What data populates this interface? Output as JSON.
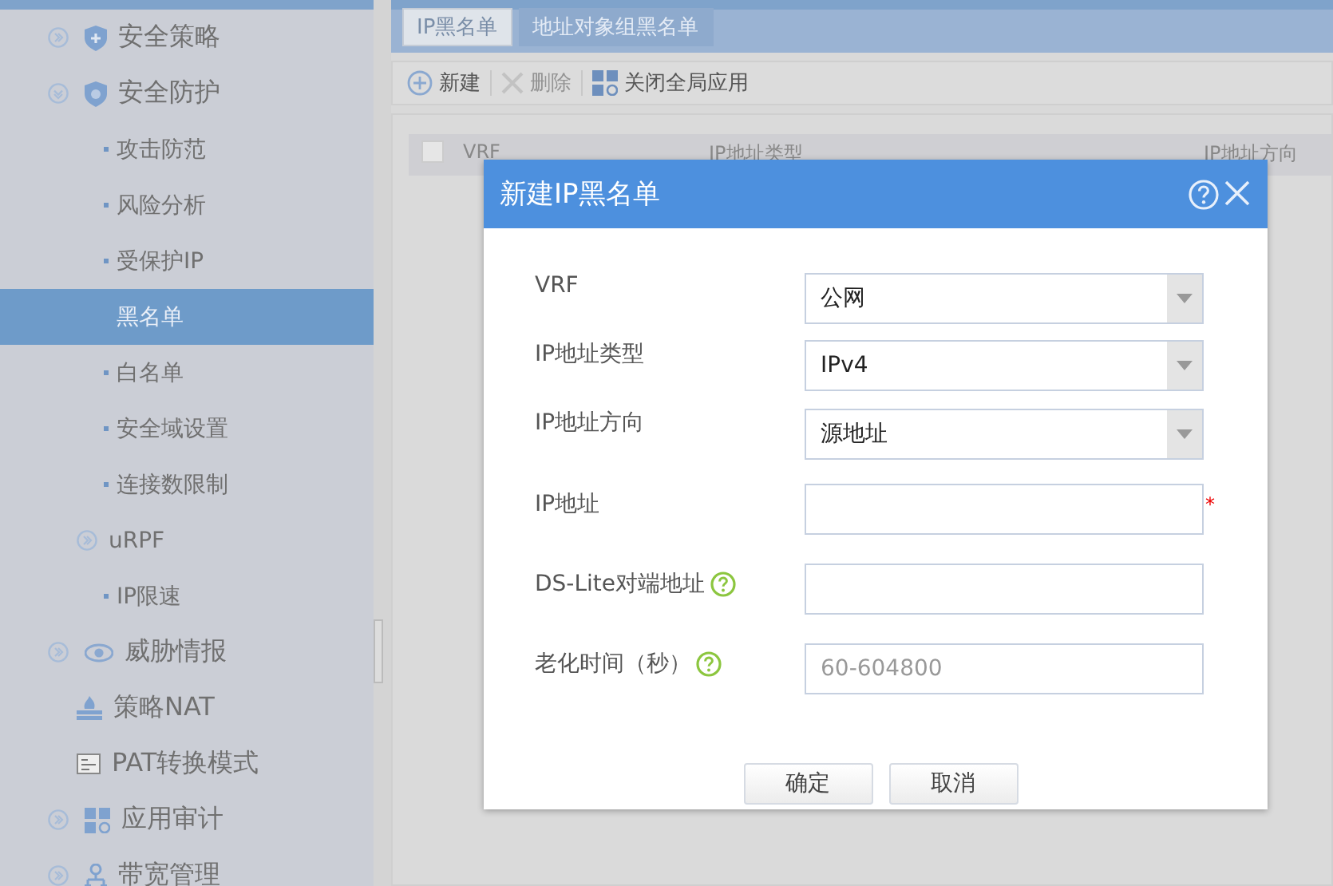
{
  "sidebar": {
    "items": [
      {
        "label": "安全策略",
        "kind": "group",
        "expanded": false,
        "selected": false
      },
      {
        "label": "安全防护",
        "kind": "group",
        "expanded": true,
        "selected": false,
        "children": [
          {
            "label": "攻击防范",
            "kind": "leaf",
            "selected": false
          },
          {
            "label": "风险分析",
            "kind": "leaf",
            "selected": false
          },
          {
            "label": "受保护IP",
            "kind": "leaf",
            "selected": false
          },
          {
            "label": "黑名单",
            "kind": "leaf",
            "selected": true
          },
          {
            "label": "白名单",
            "kind": "leaf",
            "selected": false
          },
          {
            "label": "安全域设置",
            "kind": "leaf",
            "selected": false
          },
          {
            "label": "连接数限制",
            "kind": "leaf",
            "selected": false
          },
          {
            "label": "uRPF",
            "kind": "group",
            "expanded": false,
            "selected": false
          },
          {
            "label": "IP限速",
            "kind": "leaf",
            "selected": false
          }
        ]
      },
      {
        "label": "威胁情报",
        "kind": "group",
        "expanded": false,
        "selected": false
      },
      {
        "label": "策略NAT",
        "kind": "leaf",
        "selected": false
      },
      {
        "label": "PAT转换模式",
        "kind": "leaf",
        "selected": false
      },
      {
        "label": "应用审计",
        "kind": "group",
        "expanded": false,
        "selected": false
      },
      {
        "label": "带宽管理",
        "kind": "group",
        "expanded": false,
        "selected": false
      }
    ]
  },
  "tabs": [
    {
      "label": "IP黑名单",
      "selected": true
    },
    {
      "label": "地址对象组黑名单",
      "selected": false
    }
  ],
  "toolbar": [
    {
      "label": "新建",
      "kind": "add",
      "disabled": false
    },
    {
      "label": "删除",
      "kind": "delete",
      "disabled": true
    },
    {
      "label": "关闭全局应用",
      "kind": "global",
      "disabled": false
    }
  ],
  "table": {
    "select_all": {
      "checked": false
    },
    "columns": [
      "VRF",
      "IP地址类型",
      "IP地址方向"
    ]
  },
  "dialog": {
    "title": "新建IP黑名单",
    "fields": [
      {
        "label": "VRF",
        "kind": "select",
        "value": "公网",
        "help": false
      },
      {
        "label": "IP地址类型",
        "kind": "select",
        "value": "IPv4",
        "help": false
      },
      {
        "label": "IP地址方向",
        "kind": "select",
        "value": "源地址",
        "help": false
      },
      {
        "label": "IP地址",
        "kind": "input",
        "required_mark": "*",
        "help": false
      },
      {
        "label": "DS-Lite对端地址",
        "kind": "input",
        "help": true
      },
      {
        "label": "老化时间（秒）",
        "kind": "input",
        "placeholder": "60-604800",
        "help": true
      }
    ],
    "buttons": [
      "确定",
      "取消"
    ]
  }
}
